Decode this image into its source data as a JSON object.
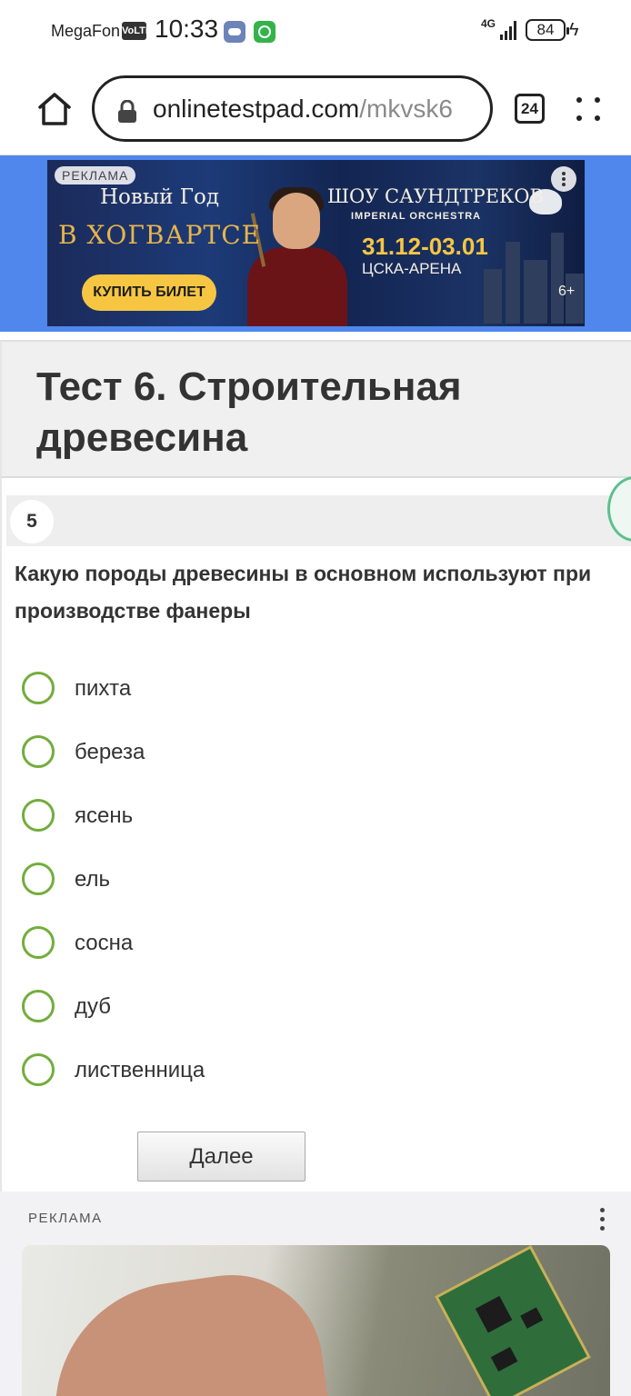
{
  "status_bar": {
    "carrier": "MegaFon",
    "volte": "VoLTE",
    "time": "10:33",
    "network": "4G",
    "battery": "84",
    "icons": [
      "cloud-icon",
      "whatsapp-icon",
      "signal-icon",
      "battery-icon",
      "charging-bolt-icon"
    ]
  },
  "browser": {
    "url_domain": "onlinetestpad.com",
    "url_path": "/mkvsk6",
    "tab_count": "24",
    "icons": [
      "home-icon",
      "lock-icon",
      "tabs-icon",
      "menu-icon"
    ]
  },
  "top_ad": {
    "badge": "РЕКЛАМА",
    "line1": "Новый Год",
    "line2": "В ХОГВАРТСЕ",
    "cta": "КУПИТЬ БИЛЕТ",
    "title": "ШОУ САУНДТРЕКОВ",
    "subtitle": "IMPERIAL ORCHESTRA",
    "dates": "31.12-03.01",
    "venue": "ЦСКА-АРЕНА",
    "age": "6+",
    "brand_color": "#4f87ec"
  },
  "test": {
    "title": "Тест 6. Строительная древесина",
    "question_number": "5",
    "question_text": "Какую породы древесины  в основном используют при производстве фанеры",
    "options": [
      "пихта",
      "береза",
      "ясень",
      "ель",
      "сосна",
      "дуб",
      "лиственница"
    ],
    "next_label": "Далее",
    "radio_color": "#73ad3c"
  },
  "bottom_ad": {
    "label": "РЕКЛАМА"
  }
}
